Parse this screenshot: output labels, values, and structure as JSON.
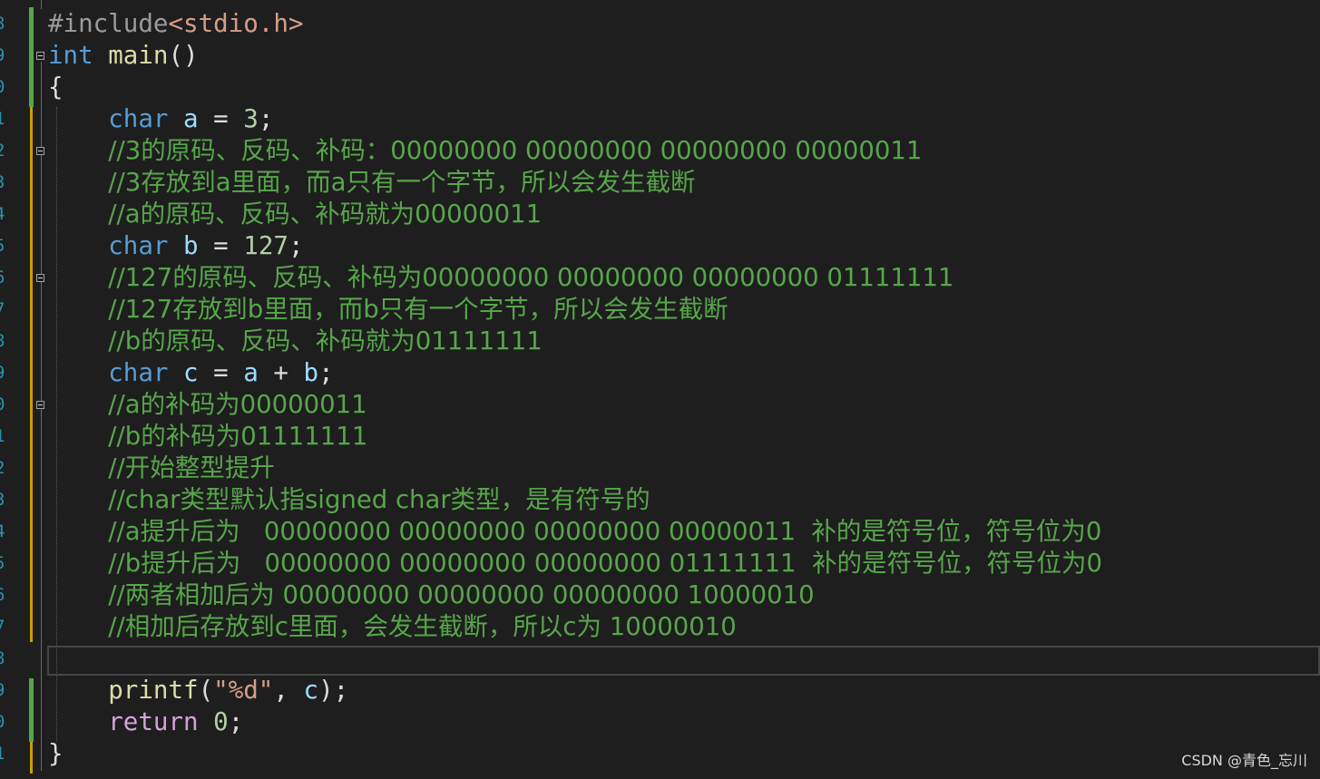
{
  "editor": {
    "line_numbers": [
      "8",
      "9",
      "0",
      "1",
      "2",
      "3",
      "4",
      "5",
      "6",
      "7",
      "8",
      "9",
      "0",
      "1",
      "2",
      "3",
      "4",
      "5",
      "6",
      "7",
      "8",
      "9",
      "0",
      "1"
    ],
    "lines": [
      [
        {
          "c": "pp",
          "t": "#include"
        },
        {
          "c": "hdr",
          "t": "<stdio.h>"
        }
      ],
      [
        {
          "c": "kw",
          "t": "int"
        },
        {
          "c": "op",
          "t": " "
        },
        {
          "c": "fn",
          "t": "main"
        },
        {
          "c": "op",
          "t": "()"
        }
      ],
      [
        {
          "c": "op",
          "t": "{"
        }
      ],
      [
        {
          "c": "op",
          "t": "    "
        },
        {
          "c": "kw",
          "t": "char"
        },
        {
          "c": "op",
          "t": " "
        },
        {
          "c": "var",
          "t": "a"
        },
        {
          "c": "op",
          "t": " = "
        },
        {
          "c": "num",
          "t": "3"
        },
        {
          "c": "op",
          "t": ";"
        }
      ],
      [
        {
          "c": "op",
          "t": "    "
        },
        {
          "c": "cmt",
          "t": "//3的原码、反码、补码：00000000 00000000 00000000 00000011"
        }
      ],
      [
        {
          "c": "op",
          "t": "    "
        },
        {
          "c": "cmt",
          "t": "//3存放到a里面，而a只有一个字节，所以会发生截断"
        }
      ],
      [
        {
          "c": "op",
          "t": "    "
        },
        {
          "c": "cmt",
          "t": "//a的原码、反码、补码就为00000011"
        }
      ],
      [
        {
          "c": "op",
          "t": "    "
        },
        {
          "c": "kw",
          "t": "char"
        },
        {
          "c": "op",
          "t": " "
        },
        {
          "c": "var",
          "t": "b"
        },
        {
          "c": "op",
          "t": " = "
        },
        {
          "c": "num",
          "t": "127"
        },
        {
          "c": "op",
          "t": ";"
        }
      ],
      [
        {
          "c": "op",
          "t": "    "
        },
        {
          "c": "cmt",
          "t": "//127的原码、反码、补码为00000000 00000000 00000000 01111111"
        }
      ],
      [
        {
          "c": "op",
          "t": "    "
        },
        {
          "c": "cmt",
          "t": "//127存放到b里面，而b只有一个字节，所以会发生截断"
        }
      ],
      [
        {
          "c": "op",
          "t": "    "
        },
        {
          "c": "cmt",
          "t": "//b的原码、反码、补码就为01111111"
        }
      ],
      [
        {
          "c": "op",
          "t": "    "
        },
        {
          "c": "kw",
          "t": "char"
        },
        {
          "c": "op",
          "t": " "
        },
        {
          "c": "var",
          "t": "c"
        },
        {
          "c": "op",
          "t": " = "
        },
        {
          "c": "var",
          "t": "a"
        },
        {
          "c": "op",
          "t": " + "
        },
        {
          "c": "var",
          "t": "b"
        },
        {
          "c": "op",
          "t": ";"
        }
      ],
      [
        {
          "c": "op",
          "t": "    "
        },
        {
          "c": "cmt",
          "t": "//a的补码为00000011"
        }
      ],
      [
        {
          "c": "op",
          "t": "    "
        },
        {
          "c": "cmt",
          "t": "//b的补码为01111111"
        }
      ],
      [
        {
          "c": "op",
          "t": "    "
        },
        {
          "c": "cmt",
          "t": "//开始整型提升"
        }
      ],
      [
        {
          "c": "op",
          "t": "    "
        },
        {
          "c": "cmt",
          "t": "//char类型默认指signed char类型，是有符号的"
        }
      ],
      [
        {
          "c": "op",
          "t": "    "
        },
        {
          "c": "cmt",
          "t": "//a提升后为   00000000 00000000 00000000 00000011  补的是符号位，符号位为0"
        }
      ],
      [
        {
          "c": "op",
          "t": "    "
        },
        {
          "c": "cmt",
          "t": "//b提升后为   00000000 00000000 00000000 01111111  补的是符号位，符号位为0"
        }
      ],
      [
        {
          "c": "op",
          "t": "    "
        },
        {
          "c": "cmt",
          "t": "//两者相加后为 00000000 00000000 00000000 10000010"
        }
      ],
      [
        {
          "c": "op",
          "t": "    "
        },
        {
          "c": "cmt",
          "t": "//相加后存放到c里面，会发生截断，所以c为 10000010"
        }
      ],
      [
        {
          "c": "op",
          "t": ""
        }
      ],
      [
        {
          "c": "op",
          "t": "    "
        },
        {
          "c": "fn",
          "t": "printf"
        },
        {
          "c": "op",
          "t": "("
        },
        {
          "c": "str",
          "t": "\"%d\""
        },
        {
          "c": "op",
          "t": ", "
        },
        {
          "c": "var",
          "t": "c"
        },
        {
          "c": "op",
          "t": ");"
        }
      ],
      [
        {
          "c": "op",
          "t": "    "
        },
        {
          "c": "ctl",
          "t": "return"
        },
        {
          "c": "op",
          "t": " "
        },
        {
          "c": "num",
          "t": "0"
        },
        {
          "c": "op",
          "t": ";"
        }
      ],
      [
        {
          "c": "op",
          "t": "}"
        }
      ]
    ]
  },
  "watermark": "CSDN @青色_忘川"
}
